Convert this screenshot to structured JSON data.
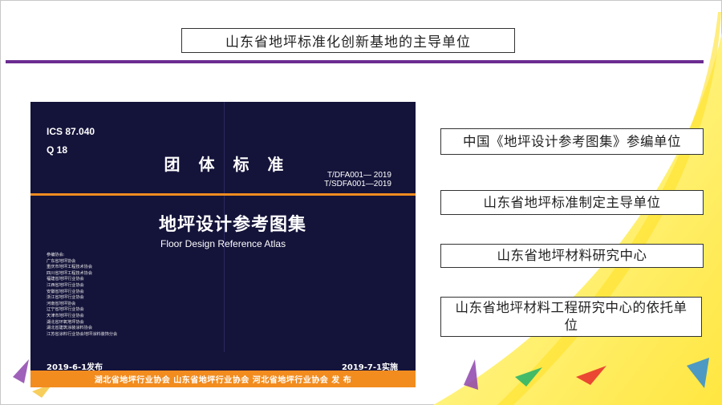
{
  "header": {
    "title": "山东省地坪标准化创新基地的主导单位"
  },
  "cover": {
    "ics": "ICS 87.040",
    "q_code": "Q  18",
    "standard_type": "团 体 标 准",
    "code_1": "T/DFA001— 2019",
    "code_2": "T/SDFA001—2019",
    "title_cn": "地坪设计参考图集",
    "title_en": "Floor Design Reference Atlas",
    "contributors": [
      "参编协会:",
      "广东省地坪协会",
      "重庆市地坪工程技术协会",
      "四川省地坪工程技术协会",
      "福建省地坪行业协会",
      "江西省地坪行业协会",
      "安徽省地坪行业协会",
      "浙江省地坪行业协会",
      "河南省地坪协会",
      "辽宁省地坪行业协会",
      "天津市地坪行业协会",
      "湖北省环氧地坪协会",
      "湖北省建筑涂装涂料协会",
      "江苏省涂料行业协会地坪涂料装饰分会"
    ],
    "publish_date": "2019-6-1发布",
    "implement_date": "2019-7-1实施",
    "publishers": "湖北省地坪行业协会 山东省地坪行业协会 河北省地坪行业协会  发 布"
  },
  "roles": [
    "中国《地坪设计参考图集》参编单位",
    "山东省地坪标准制定主导单位",
    "山东省地坪材料研究中心",
    "山东省地坪材料工程研究中心的依托单位"
  ],
  "colors": {
    "accent_purple": "#6b2c91",
    "cover_navy": "#14133a",
    "cover_orange": "#f28c1f",
    "swoosh_yellow": "#fff27a"
  }
}
